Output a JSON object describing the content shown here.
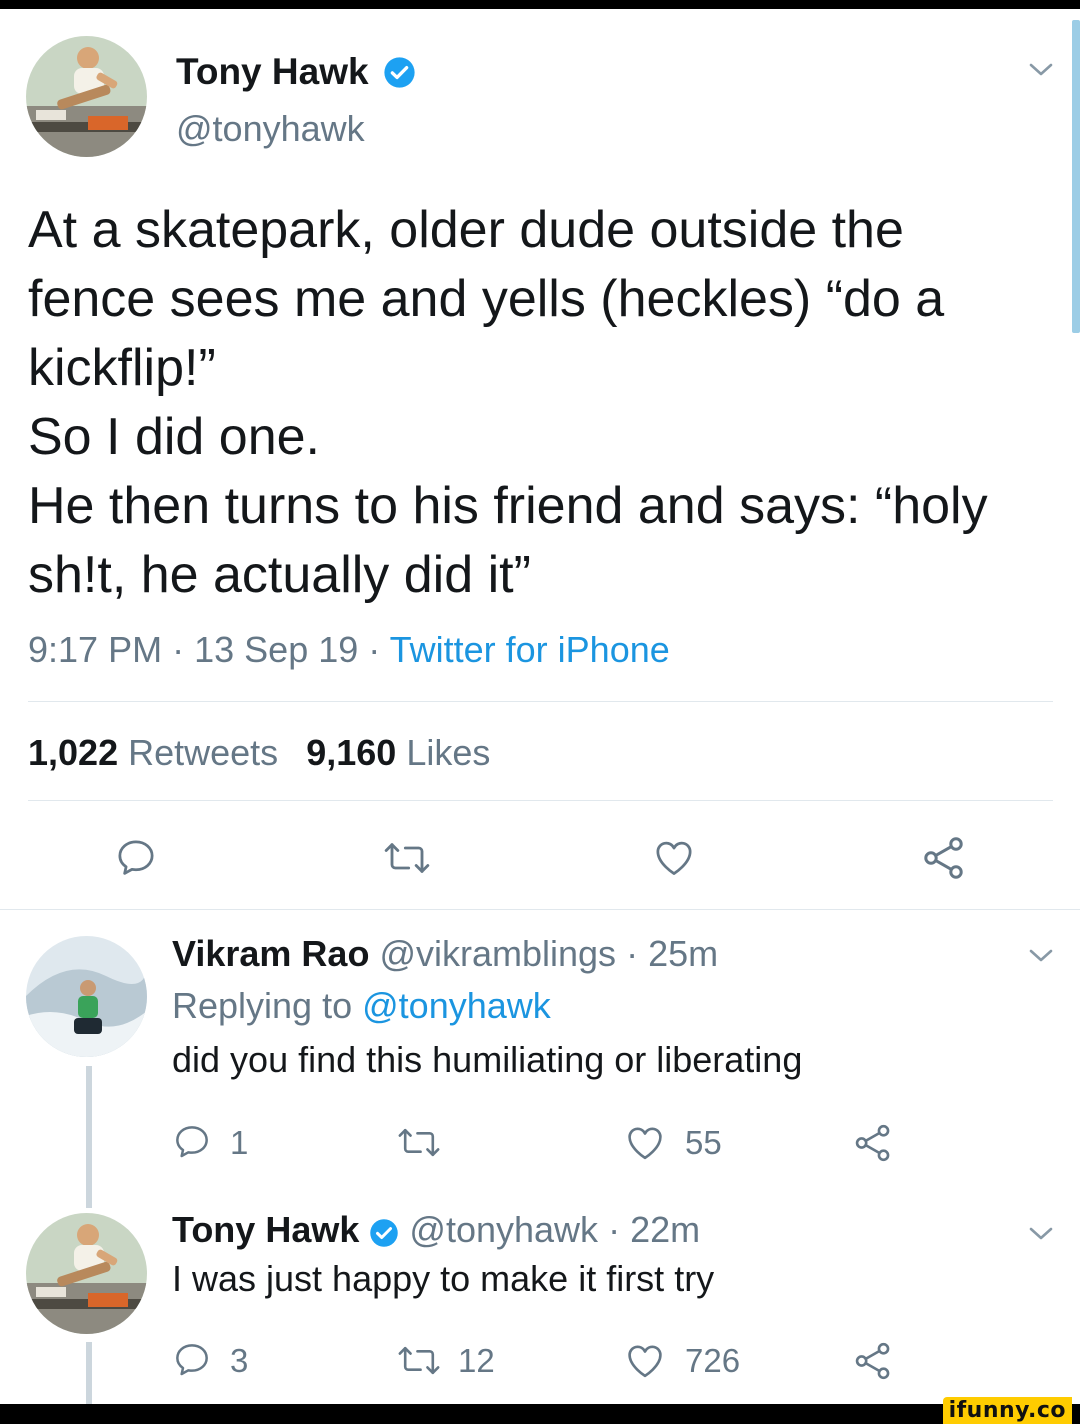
{
  "main_tweet": {
    "author_name": "Tony Hawk",
    "author_handle": "@tonyhawk",
    "text_lines": [
      "At a skatepark, older dude outside the",
      "fence sees me and yells (heckles) “do a",
      "kickflip!”",
      "So I did one.",
      "He then turns to his friend and says: “holy",
      "sh!t, he actually did it”"
    ],
    "time": "9:17 PM",
    "date": "13 Sep 19",
    "source": "Twitter for iPhone",
    "separator": "·",
    "retweets_count": "1,022",
    "retweets_label": "Retweets",
    "likes_count": "9,160",
    "likes_label": "Likes"
  },
  "reply_1": {
    "author_name": "Vikram Rao",
    "author_handle": "@vikramblings",
    "time_ago": "25m",
    "replying_label": "Replying to",
    "replying_handle": "@tonyhawk",
    "text": "did you find this humiliating or liberating",
    "reply_count": "1",
    "retweet_count": "",
    "like_count": "55"
  },
  "reply_2": {
    "author_name": "Tony Hawk",
    "author_handle": "@tonyhawk",
    "time_ago": "22m",
    "text": "I was just happy to make it first try",
    "reply_count": "3",
    "retweet_count": "12",
    "like_count": "726"
  },
  "watermark": "ifunny.co",
  "icons": {
    "reply": "reply-icon",
    "retweet": "retweet-icon",
    "like": "heart-icon",
    "share": "share-icon",
    "verified": "verified-badge-icon",
    "chevron": "chevron-down-icon"
  },
  "colors": {
    "accent": "#1b95e0",
    "muted": "#657786",
    "text": "#14171a",
    "divider": "#e1e8ed"
  }
}
